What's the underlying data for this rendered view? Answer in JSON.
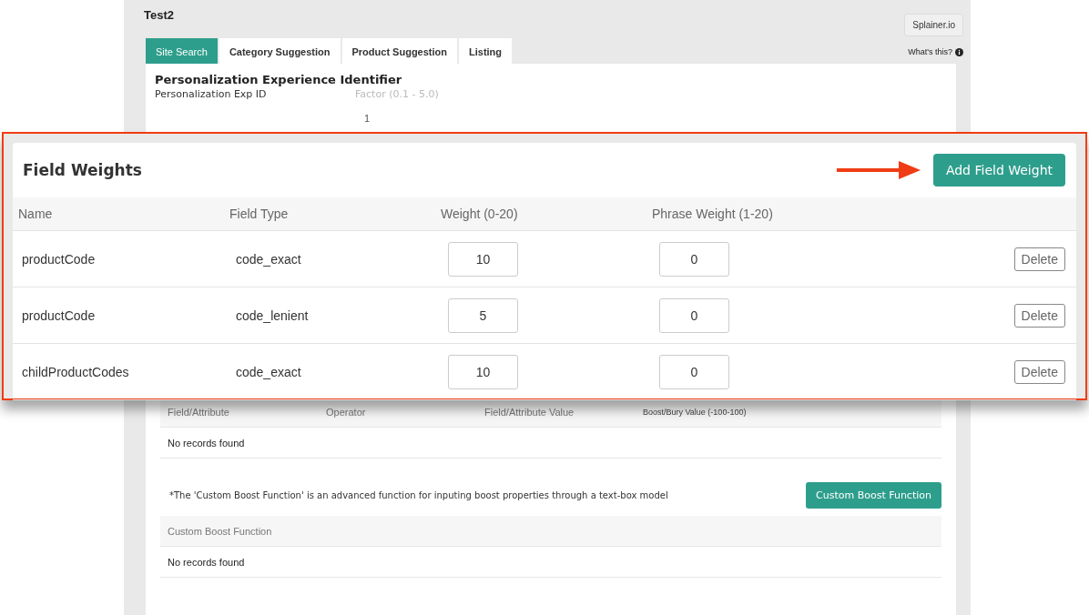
{
  "page": {
    "title": "Test2",
    "help_button": "Splainer.io",
    "whats_this": "What's this?",
    "tabs": [
      {
        "label": "Site Search",
        "selected": true
      },
      {
        "label": "Category Suggestion",
        "selected": false
      },
      {
        "label": "Product Suggestion",
        "selected": false
      },
      {
        "label": "Listing",
        "selected": false
      }
    ],
    "personalization": {
      "heading": "Personalization Experience Identifier",
      "label": "Personalization Exp ID",
      "factor_hint": "Factor (0.1 - 5.0)",
      "factor_value": "1"
    },
    "boost_table": {
      "columns": [
        "Field/Attribute",
        "Operator",
        "Field/Attribute Value",
        "Boost/Bury Value (-100-100)"
      ],
      "empty": "No records found"
    },
    "custom_boost": {
      "note": "*The 'Custom Boost Function' is an advanced function for inputing boost properties through a text-box model",
      "button": "Custom Boost Function",
      "columns": [
        "Custom Boost Function"
      ],
      "empty": "No records found"
    }
  },
  "callout": {
    "title": "Field Weights",
    "add_button": "Add Field Weight",
    "columns": [
      "Name",
      "Field Type",
      "Weight (0-20)",
      "Phrase Weight (1-20)"
    ],
    "rows": [
      {
        "name": "productCode",
        "field_type": "code_exact",
        "weight": "10",
        "phrase_weight": "0",
        "action": "Delete"
      },
      {
        "name": "productCode",
        "field_type": "code_lenient",
        "weight": "5",
        "phrase_weight": "0",
        "action": "Delete"
      },
      {
        "name": "childProductCodes",
        "field_type": "code_exact",
        "weight": "10",
        "phrase_weight": "0",
        "action": "Delete"
      }
    ]
  }
}
